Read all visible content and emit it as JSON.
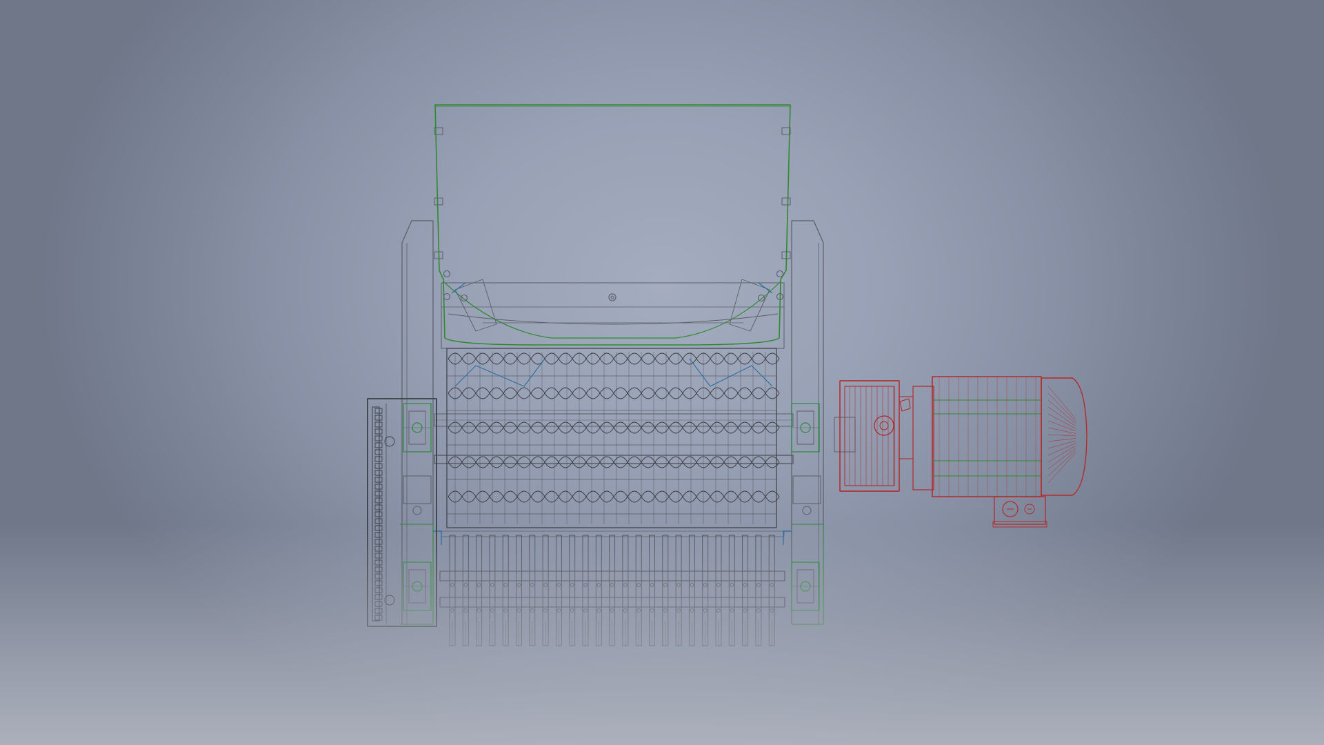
{
  "view": {
    "background": {
      "center": "#a4acbf",
      "edge": "#6f7789",
      "floor": "#babec8"
    }
  },
  "model": {
    "colors": {
      "frame": "#5a5e66",
      "hopper": "#2f8a2f",
      "chains": "#3b3f46",
      "bearings": "#2b8c3a",
      "guides": "#2a6fa0",
      "gearbox": "#b22222",
      "motor_housing": "#b22a2a",
      "motor_bands": "#2e8b2e",
      "screen": "#4a4d53"
    },
    "rotor_rows": 5,
    "screen_bars": 25
  }
}
